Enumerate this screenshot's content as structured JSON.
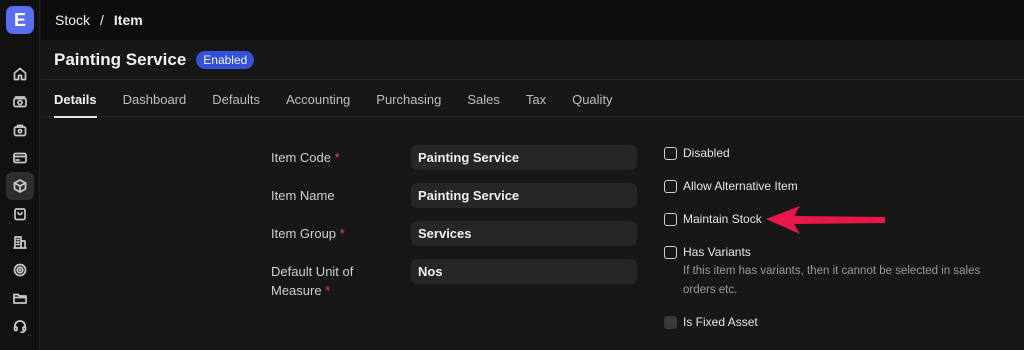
{
  "app": {
    "logo_letter": "E"
  },
  "sidebar": {
    "items": [
      {
        "icon": "home-icon"
      },
      {
        "icon": "accounting-icon"
      },
      {
        "icon": "buying-icon"
      },
      {
        "icon": "selling-icon"
      },
      {
        "icon": "stock-icon",
        "active": true
      },
      {
        "icon": "shopping-bag-icon"
      },
      {
        "icon": "building-icon"
      },
      {
        "icon": "target-icon"
      },
      {
        "icon": "folder-icon"
      },
      {
        "icon": "support-icon"
      }
    ]
  },
  "breadcrumb": {
    "items": [
      "Stock",
      "Item"
    ],
    "separator": "/"
  },
  "header": {
    "title": "Painting Service",
    "status": "Enabled"
  },
  "tabs": [
    "Details",
    "Dashboard",
    "Defaults",
    "Accounting",
    "Purchasing",
    "Sales",
    "Tax",
    "Quality"
  ],
  "form": {
    "item_code": {
      "label": "Item Code",
      "required_mark": "*",
      "value": "Painting Service"
    },
    "item_name": {
      "label": "Item Name",
      "value": "Painting Service"
    },
    "item_group": {
      "label": "Item Group",
      "required_mark": "*",
      "value": "Services"
    },
    "uom": {
      "label_line1": "Default Unit of",
      "label_line2": "Measure",
      "required_mark": "*",
      "value": "Nos"
    }
  },
  "checks": {
    "disabled": {
      "label": "Disabled",
      "checked": false
    },
    "allow_alternative": {
      "label": "Allow Alternative Item",
      "checked": false
    },
    "maintain_stock": {
      "label": "Maintain Stock",
      "checked": false
    },
    "has_variants": {
      "label": "Has Variants",
      "checked": false,
      "description_line1": "If this item has variants, then it cannot be selected in sales",
      "description_line2": "orders etc."
    },
    "is_fixed_asset": {
      "label": "Is Fixed Asset",
      "checked": false,
      "disabled": true
    }
  },
  "colors": {
    "accent": "#5a6ff0",
    "badge": "#3651d6",
    "annotation": "#e8184a"
  }
}
